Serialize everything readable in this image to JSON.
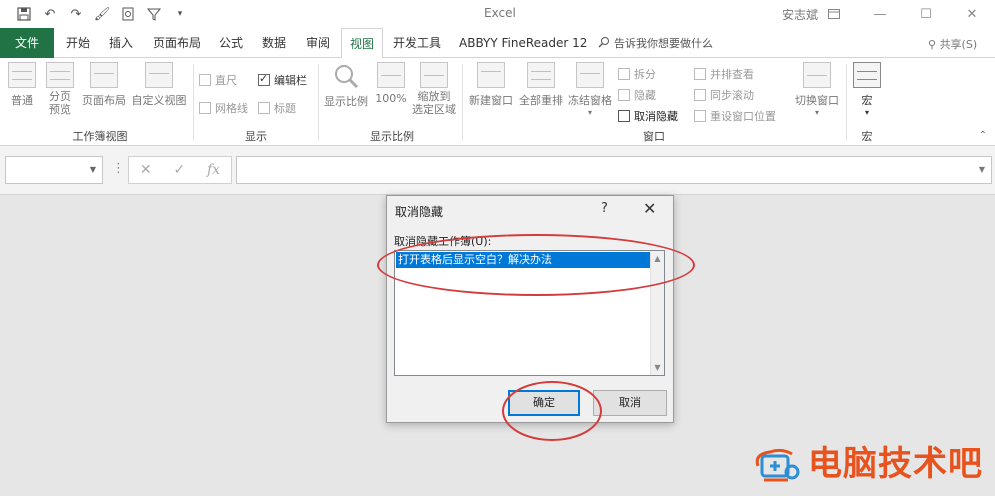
{
  "titlebar": {
    "app_title": "Excel",
    "user_name": "安志斌",
    "qat_icons": [
      "save-icon",
      "undo-icon",
      "redo-icon",
      "paint-icon",
      "print-preview-icon",
      "filter-icon"
    ]
  },
  "tabs": {
    "file": "文件",
    "items": [
      "开始",
      "插入",
      "页面布局",
      "公式",
      "数据",
      "审阅",
      "视图",
      "开发工具",
      "ABBYY FineReader 12"
    ],
    "active": "视图",
    "tell_me": "告诉我你想要做什么",
    "share": "共享(S)"
  },
  "ribbon": {
    "workbook_views": {
      "buttons": [
        "普通",
        "分页\n预览",
        "页面布局",
        "自定义视图"
      ],
      "label": "工作簿视图"
    },
    "show": {
      "ruler": "直尺",
      "formula_bar": "编辑栏",
      "gridlines": "网格线",
      "headings": "标题",
      "label": "显示"
    },
    "zoom": {
      "zoom": "显示比例",
      "hundred": "100%",
      "zoom_selection": "缩放到\n选定区域",
      "label": "显示比例"
    },
    "window": {
      "new_window": "新建窗口",
      "arrange_all": "全部重排",
      "freeze_panes": "冻结窗格",
      "split": "拆分",
      "hide": "隐藏",
      "unhide": "取消隐藏",
      "side_by_side": "并排查看",
      "sync_scroll": "同步滚动",
      "reset_position": "重设窗口位置",
      "switch_windows": "切换窗口",
      "label": "窗口"
    },
    "macros": {
      "button": "宏",
      "label": "宏"
    }
  },
  "dialog": {
    "title": "取消隐藏",
    "help": "?",
    "close": "✕",
    "list_label": "取消隐藏工作簿(U):",
    "items": [
      "打开表格后显示空白？解决办法"
    ],
    "ok": "确定",
    "cancel": "取消"
  },
  "watermark": {
    "text": "电脑技术吧"
  },
  "colors": {
    "excel_green": "#217346",
    "selection_blue": "#0078d7",
    "annotation_red": "#d43b3b",
    "watermark_orange": "#e8531d"
  }
}
